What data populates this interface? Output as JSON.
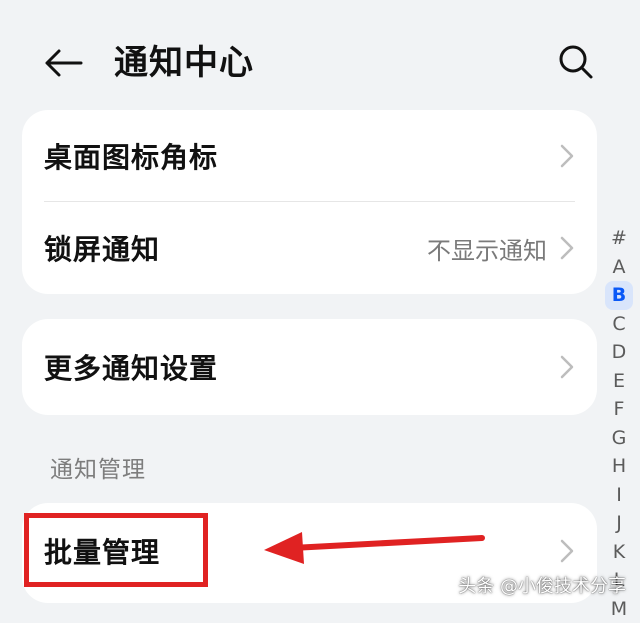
{
  "header": {
    "title": "通知中心",
    "back_icon": "arrow-left-icon",
    "search_icon": "search-icon"
  },
  "card_top": {
    "rows": [
      {
        "label": "桌面图标角标",
        "value": ""
      },
      {
        "label": "锁屏通知",
        "value": "不显示通知"
      }
    ]
  },
  "card_more": {
    "label": "更多通知设置"
  },
  "section": {
    "title": "通知管理"
  },
  "batch": {
    "label": "批量管理"
  },
  "alpha_index": {
    "letters": [
      "#",
      "A",
      "B",
      "C",
      "D",
      "E",
      "F",
      "G",
      "H",
      "I",
      "J",
      "K",
      "L",
      "M"
    ],
    "active": "B"
  },
  "annotation": {
    "color": "#e02222"
  },
  "watermark": {
    "text": "头条 @小俊技术分享"
  },
  "colors": {
    "background": "#f1f3f5",
    "card": "#ffffff",
    "accent": "#0a59f7"
  }
}
